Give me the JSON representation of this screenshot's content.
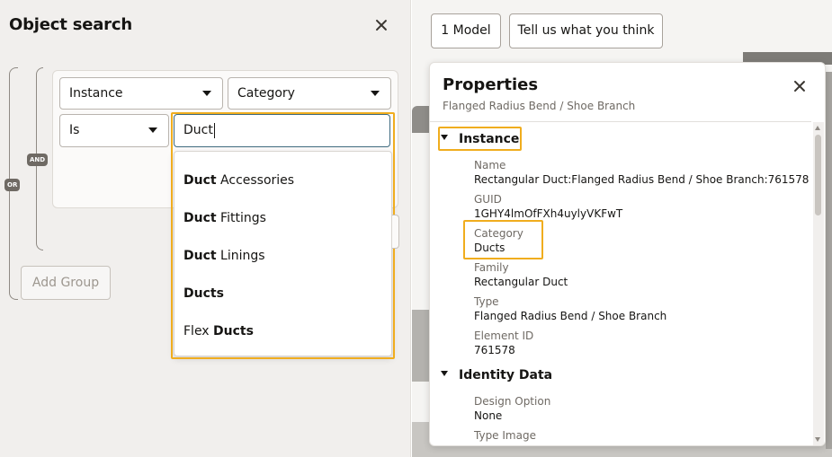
{
  "search_panel": {
    "title": "Object search",
    "or_badge": "OR",
    "and_badge": "AND",
    "filter": {
      "scope_select": "Instance",
      "field_select": "Category",
      "operator_select": "Is",
      "value_input": "Duct"
    },
    "suggestions": [
      {
        "bold": "Duct",
        "rest": " Accessories"
      },
      {
        "bold": "Duct",
        "rest": " Fittings"
      },
      {
        "bold": "Duct",
        "rest": " Linings"
      },
      {
        "bold": "Duct",
        "rest": "s"
      },
      {
        "pre": "Flex ",
        "bold": "Duct",
        "rest": "s"
      }
    ],
    "add_group_label": "Add Group"
  },
  "viewer": {
    "model_button": "1 Model",
    "feedback_button": "Tell us what you think"
  },
  "properties": {
    "title": "Properties",
    "subtitle": "Flanged Radius Bend / Shoe Branch",
    "instance_section": "Instance",
    "fields": [
      {
        "label": "Name",
        "value": "Rectangular Duct:Flanged Radius Bend / Shoe Branch:761578"
      },
      {
        "label": "GUID",
        "value": "1GHY4lmOfFXh4uylyVKFwT"
      },
      {
        "label": "Category",
        "value": "Ducts"
      },
      {
        "label": "Family",
        "value": "Rectangular Duct"
      },
      {
        "label": "Type",
        "value": "Flanged Radius Bend / Shoe Branch"
      },
      {
        "label": "Element ID",
        "value": "761578"
      }
    ],
    "identity_section": "Identity Data",
    "identity_fields": [
      {
        "label": "Design Option",
        "value": "None"
      },
      {
        "label": "Type Image",
        "value": ""
      }
    ]
  },
  "colors": {
    "highlight": "#f0ad1e",
    "input_focus_border": "#3e6a7f",
    "panel_bg": "#f1efed"
  }
}
